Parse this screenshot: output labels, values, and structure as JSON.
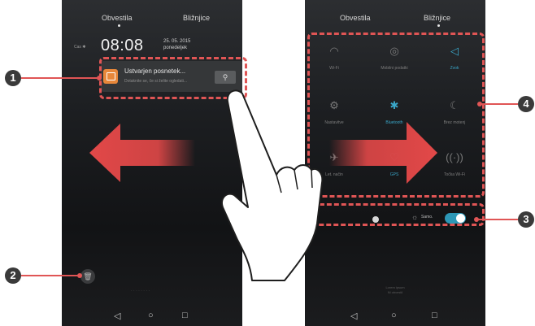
{
  "left_phone": {
    "tabs": [
      "Obvestila",
      "Bližnjice"
    ],
    "carrier": "Cas ✱",
    "time": "08:08",
    "date_line1": "25. 05. 2015",
    "date_line2": "ponedeljek",
    "notification": {
      "title": "Ustvarjen posnetek...",
      "text": "Dotaknite se, če si želite ogledati...",
      "share_icon": "share-icon"
    },
    "trash_icon": "trash-icon",
    "bottom_hint": "· · · · · · · ·"
  },
  "right_phone": {
    "tabs": [
      "Obvestila",
      "Bližnjice"
    ],
    "toggles": [
      {
        "label": "Wi-Fi",
        "icon": "wifi-icon",
        "active": false
      },
      {
        "label": "Mobilni podatki",
        "icon": "mobile-data-icon",
        "active": false
      },
      {
        "label": "Zvok",
        "icon": "sound-icon",
        "active": true
      },
      {
        "label": "Nastavitve",
        "icon": "settings-icon",
        "active": false
      },
      {
        "label": "Bluetooth",
        "icon": "bluetooth-icon",
        "active": true
      },
      {
        "label": "Brez motenj",
        "icon": "do-not-disturb-icon",
        "active": false
      },
      {
        "label": "Let. način",
        "icon": "airplane-mode-icon",
        "active": false
      },
      {
        "label": "GPS",
        "icon": "gps-icon",
        "active": true
      },
      {
        "label": "Točka Wi-Fi",
        "icon": "hotspot-icon",
        "active": false
      }
    ],
    "brightness_auto": "Samo.",
    "bottom_note_line1": "Lorem ipsum",
    "bottom_note_line2": "Ni obvestil"
  },
  "callouts": [
    "1",
    "2",
    "3",
    "4"
  ],
  "nav_buttons": [
    "◁",
    "○",
    "□"
  ],
  "colors": {
    "callout_red": "#e05555",
    "active_blue": "#3aa7c9",
    "notif_orange": "#e7873a"
  }
}
